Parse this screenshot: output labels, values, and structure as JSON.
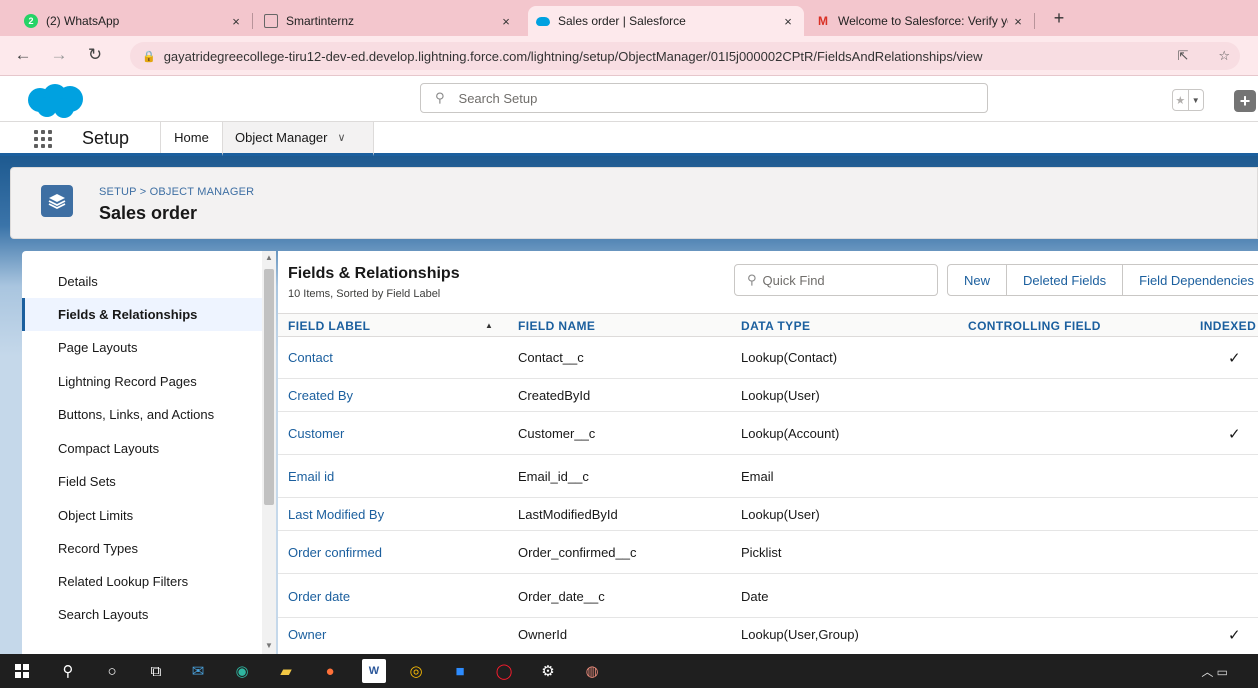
{
  "browser": {
    "tabs": [
      {
        "title": "(2) WhatsApp",
        "badge": "2",
        "icon": "whatsapp-icon",
        "active": false
      },
      {
        "title": "Smartinternz",
        "icon": "smartinternz-icon",
        "active": false
      },
      {
        "title": "Sales order | Salesforce",
        "icon": "salesforce-icon",
        "active": true
      },
      {
        "title": "Welcome to Salesforce: Verify yo",
        "icon": "gmail-icon",
        "active": false
      }
    ],
    "close_glyph": "×",
    "newtab_glyph": "+",
    "url": "gayatridegreecollege-tiru12-dev-ed.develop.lightning.force.com/lightning/setup/ObjectManager/01I5j000002CPtR/FieldsAndRelationships/view"
  },
  "header": {
    "search_placeholder": "Search Setup"
  },
  "context_nav": {
    "app_name": "Setup",
    "tabs": [
      {
        "label": "Home"
      },
      {
        "label": "Object Manager"
      }
    ]
  },
  "page_header": {
    "breadcrumb": "SETUP > OBJECT MANAGER",
    "title": "Sales order"
  },
  "left_nav": {
    "items": [
      {
        "label": "Details"
      },
      {
        "label": "Fields & Relationships",
        "active": true
      },
      {
        "label": "Page Layouts"
      },
      {
        "label": "Lightning Record Pages"
      },
      {
        "label": "Buttons, Links, and Actions"
      },
      {
        "label": "Compact Layouts"
      },
      {
        "label": "Field Sets"
      },
      {
        "label": "Object Limits"
      },
      {
        "label": "Record Types"
      },
      {
        "label": "Related Lookup Filters"
      },
      {
        "label": "Search Layouts"
      }
    ]
  },
  "main": {
    "title": "Fields & Relationships",
    "subtitle": "10 Items, Sorted by Field Label",
    "quick_find_placeholder": "Quick Find",
    "buttons": [
      "New",
      "Deleted Fields",
      "Field Dependencies"
    ],
    "columns": [
      "FIELD LABEL",
      "FIELD NAME",
      "DATA TYPE",
      "CONTROLLING FIELD",
      "INDEXED"
    ],
    "rows": [
      {
        "label": "Contact",
        "name": "Contact__c",
        "type": "Lookup(Contact)",
        "indexed": true
      },
      {
        "label": "Created By",
        "name": "CreatedById",
        "type": "Lookup(User)",
        "indexed": false
      },
      {
        "label": "Customer",
        "name": "Customer__c",
        "type": "Lookup(Account)",
        "indexed": true
      },
      {
        "label": "Email id",
        "name": "Email_id__c",
        "type": "Email",
        "indexed": false
      },
      {
        "label": "Last Modified By",
        "name": "LastModifiedById",
        "type": "Lookup(User)",
        "indexed": false
      },
      {
        "label": "Order confirmed",
        "name": "Order_confirmed__c",
        "type": "Picklist",
        "indexed": false
      },
      {
        "label": "Order date",
        "name": "Order_date__c",
        "type": "Date",
        "indexed": false
      },
      {
        "label": "Owner",
        "name": "OwnerId",
        "type": "Lookup(User,Group)",
        "indexed": true
      }
    ]
  },
  "glyphs": {
    "check": "✓",
    "sort_asc": "▲"
  },
  "colors": {
    "brand_blue": "#1b5f9e",
    "salesforce_cloud": "#00a1e0",
    "tabbar_pink": "#f3c6cd"
  }
}
